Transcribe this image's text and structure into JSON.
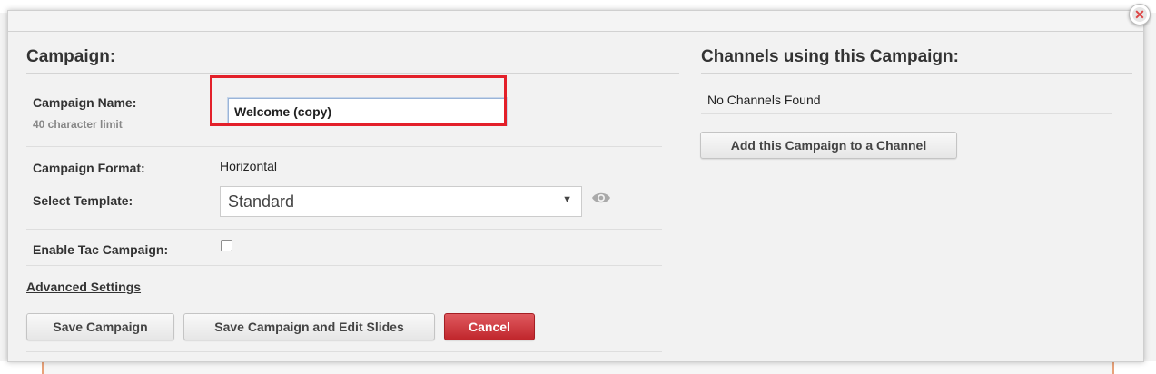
{
  "dialog": {
    "close_icon": "close-x-icon"
  },
  "campaign": {
    "section_title": "Campaign:",
    "name_label": "Campaign Name:",
    "name_hint": "40 character limit",
    "name_value": "Welcome (copy)",
    "format_label": "Campaign Format:",
    "format_value": "Horizontal",
    "template_label": "Select Template:",
    "template_selected": "Standard",
    "tac_label": "Enable Tac Campaign:",
    "tac_checked": false,
    "advanced_link": "Advanced Settings"
  },
  "actions": {
    "save": "Save Campaign",
    "save_edit": "Save Campaign and Edit Slides",
    "cancel": "Cancel"
  },
  "channels": {
    "section_title": "Channels using this Campaign:",
    "empty_text": "No Channels Found",
    "add_button": "Add this Campaign to a Channel"
  },
  "colors": {
    "highlight": "#e3202a",
    "cancel": "#c7353a"
  }
}
